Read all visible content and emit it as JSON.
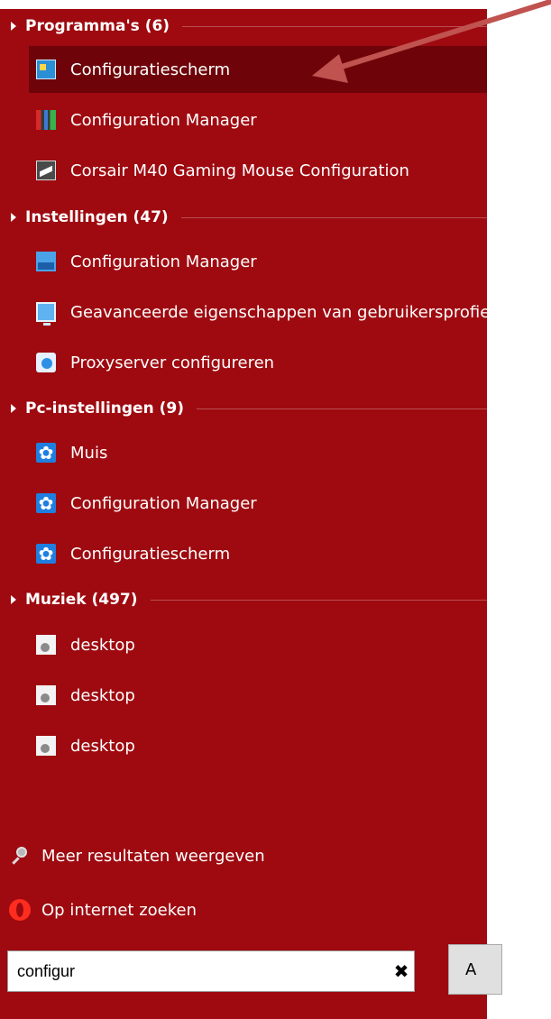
{
  "colors": {
    "panel_bg": "#9e0a10",
    "selected_bg": "#6e0409",
    "text": "#ffffff",
    "arrow": "#c0524f"
  },
  "groups": [
    {
      "header": "Programma's (6)",
      "items": [
        {
          "label": "Configuratiescherm",
          "icon": "control-panel-icon",
          "selected": true
        },
        {
          "label": "Configuration Manager",
          "icon": "configuration-manager-icon"
        },
        {
          "label": "Corsair M40 Gaming Mouse Configuration",
          "icon": "corsair-icon"
        }
      ]
    },
    {
      "header": "Instellingen (47)",
      "items": [
        {
          "label": "Configuration Manager",
          "icon": "configuration-settings-icon"
        },
        {
          "label": "Geavanceerde eigenschappen van gebruikersprofielen",
          "icon": "monitor-icon"
        },
        {
          "label": "Proxyserver configureren",
          "icon": "proxy-icon"
        }
      ]
    },
    {
      "header": "Pc-instellingen (9)",
      "items": [
        {
          "label": "Muis",
          "icon": "gear-icon"
        },
        {
          "label": "Configuration Manager",
          "icon": "gear-icon"
        },
        {
          "label": "Configuratiescherm",
          "icon": "gear-icon"
        }
      ]
    },
    {
      "header": "Muziek (497)",
      "items": [
        {
          "label": "desktop",
          "icon": "settings-file-icon"
        },
        {
          "label": "desktop",
          "icon": "settings-file-icon"
        },
        {
          "label": "desktop",
          "icon": "settings-file-icon"
        }
      ]
    }
  ],
  "more_results": "Meer resultaten weergeven",
  "internet_search": "Op internet zoeken",
  "search": {
    "value": "configur",
    "placeholder": ""
  },
  "apply_button": "A"
}
